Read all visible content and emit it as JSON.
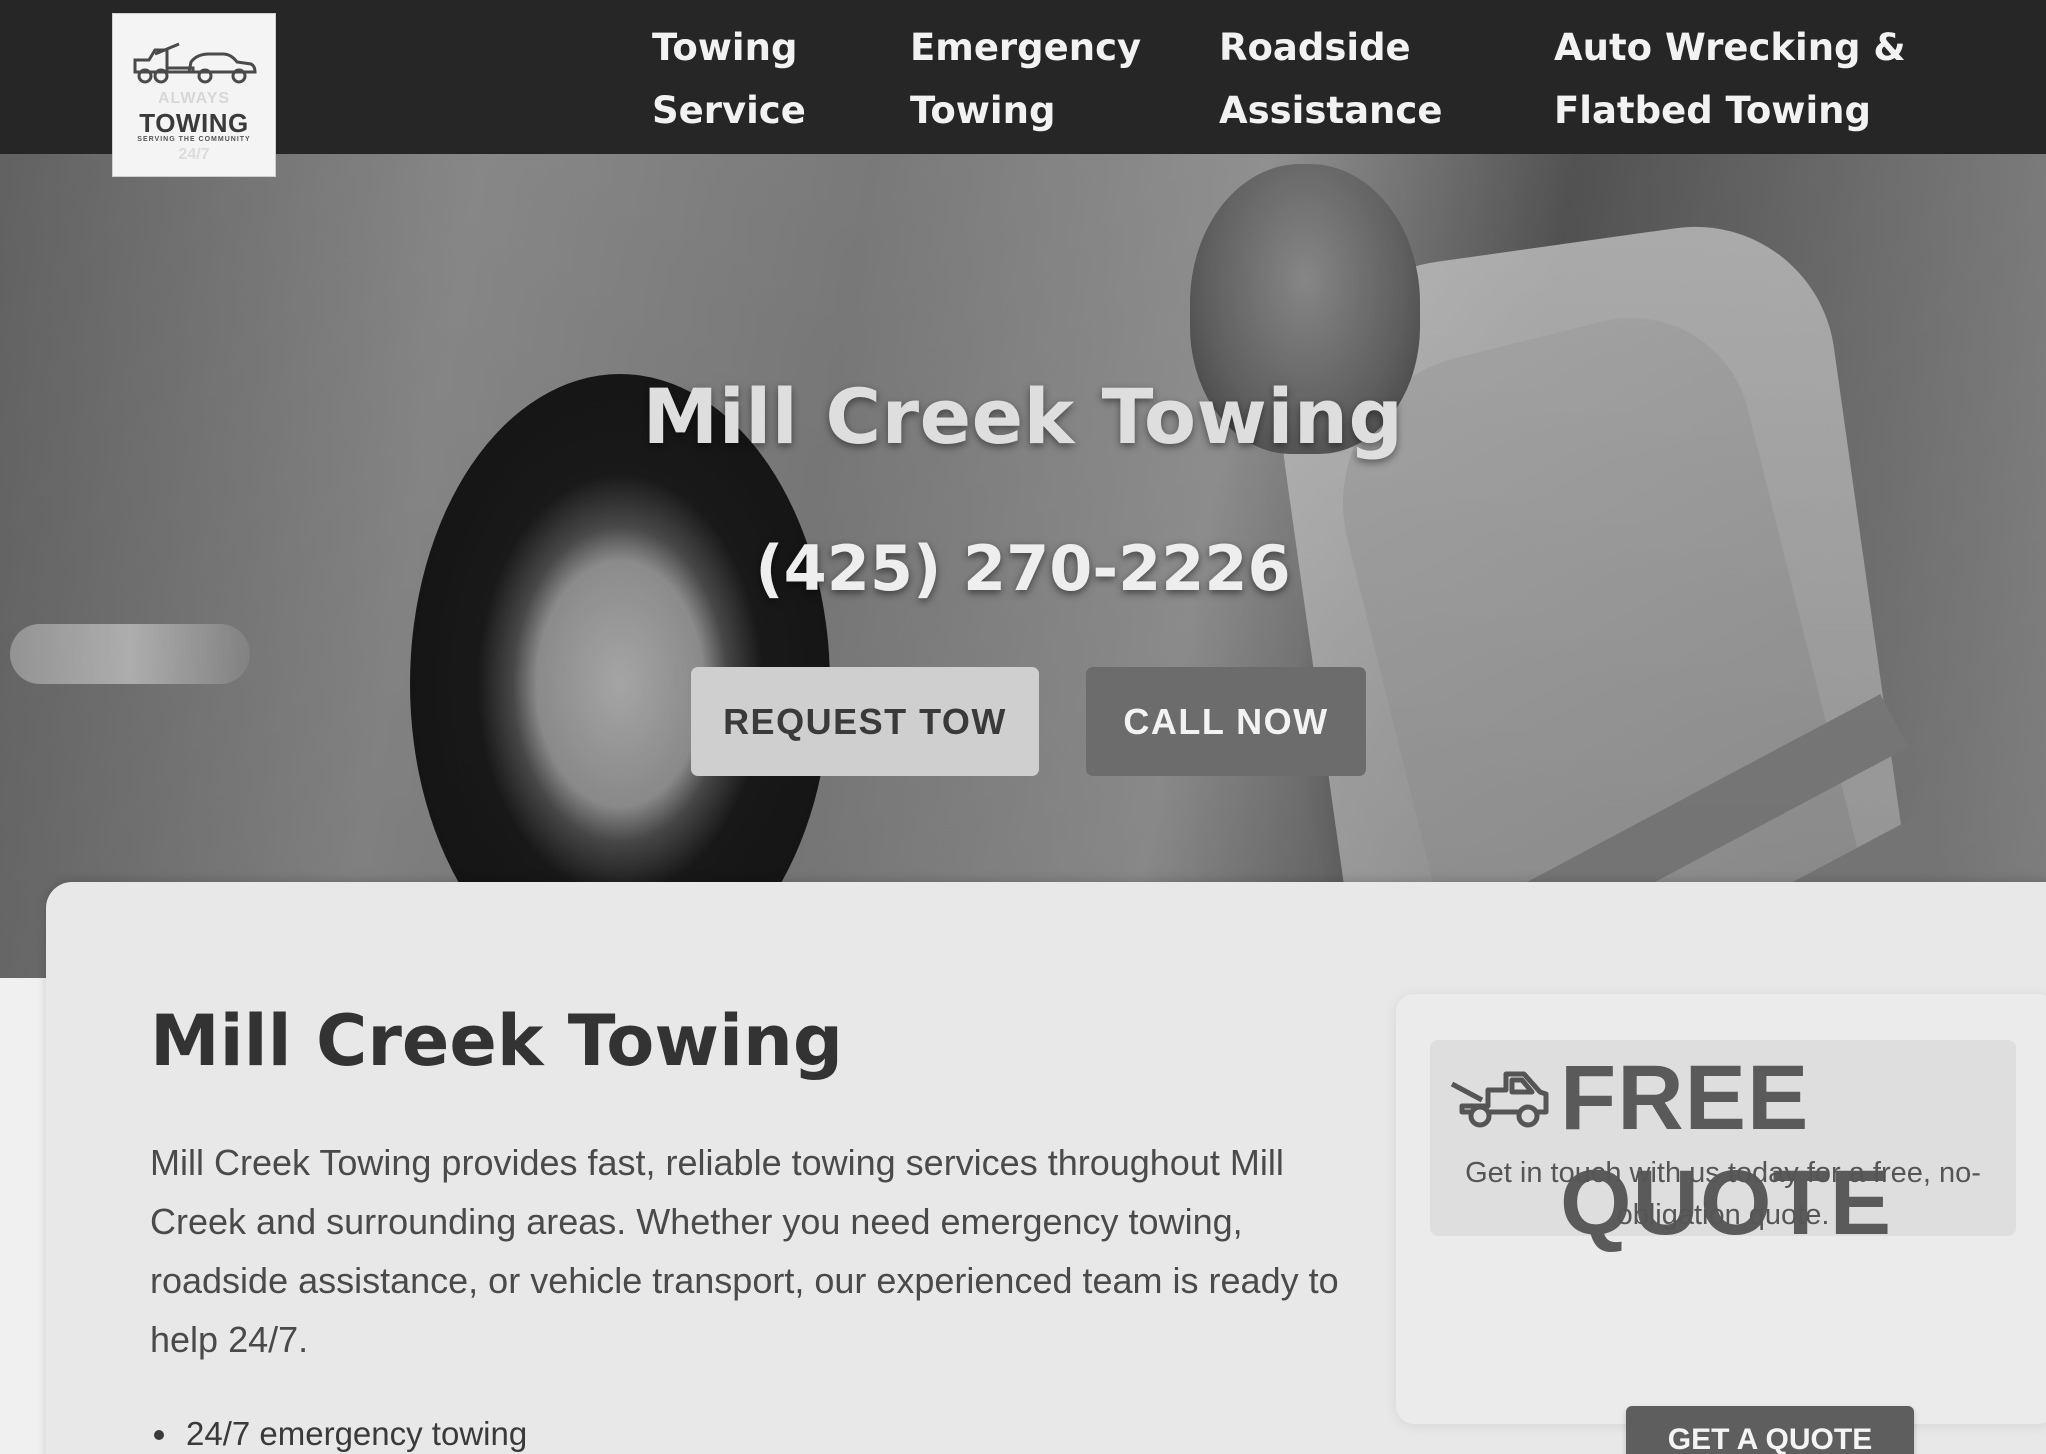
{
  "brand": {
    "logo_top": "ALWAYS",
    "logo_main": "TOWING",
    "logo_tagline": "SERVING THE COMMUNITY",
    "logo_bottom": "24/7"
  },
  "nav": {
    "items": [
      {
        "line1": "Towing",
        "line2": "Service"
      },
      {
        "line1": "Emergency",
        "line2": "Towing"
      },
      {
        "line1": "Roadside",
        "line2": "Assistance"
      },
      {
        "line1": "Auto Wrecking &",
        "line2": "Flatbed Towing"
      }
    ]
  },
  "hero": {
    "title": "Mill Creek Towing",
    "phone": "(425) 270-2226",
    "request_button": "REQUEST TOW",
    "call_button": "CALL NOW"
  },
  "intro": {
    "title": "Mill Creek Towing",
    "text": "Mill Creek Towing provides fast, reliable towing services throughout Mill Creek and surrounding areas. Whether you need emergency towing, roadside assistance, or vehicle transport, our experienced team is ready to help 24/7.",
    "list": [
      "24/7 emergency towing"
    ]
  },
  "quote": {
    "title": "FREE QUOTE",
    "subtitle": "Get in touch with us today for a free, no-obligation quote.",
    "button": "GET A QUOTE"
  },
  "icons": {
    "logo": "tow-truck-icon",
    "quote": "tow-truck-icon"
  }
}
